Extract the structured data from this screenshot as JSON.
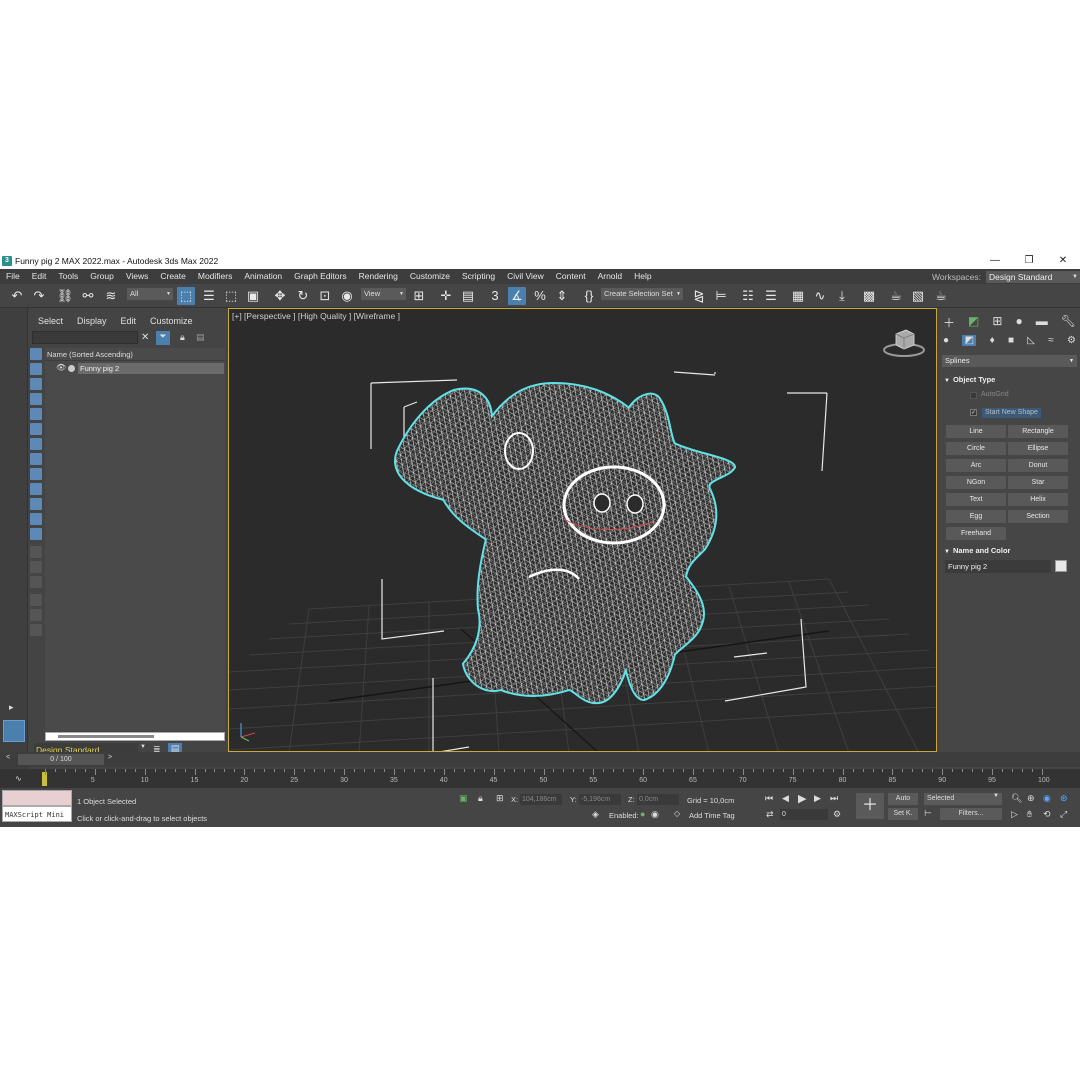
{
  "window": {
    "title": "Funny pig 2 MAX 2022.max - Autodesk 3ds Max 2022",
    "minimize": "—",
    "maximize": "❐",
    "close": "✕"
  },
  "menu": [
    "File",
    "Edit",
    "Tools",
    "Group",
    "Views",
    "Create",
    "Modifiers",
    "Animation",
    "Graph Editors",
    "Rendering",
    "Customize",
    "Scripting",
    "Civil View",
    "Content",
    "Arnold",
    "Help"
  ],
  "workspaces": {
    "label": "Workspaces:",
    "value": "Design Standard"
  },
  "toolbar": {
    "filter_value": "All",
    "ref_coord_value": "View",
    "selection_set_value": "Create Selection Set"
  },
  "scene_explorer": {
    "tabs": [
      "Select",
      "Display",
      "Edit",
      "Customize"
    ],
    "column_header": "Name (Sorted Ascending)",
    "items": [
      {
        "name": "Funny pig 2"
      }
    ],
    "workspace": "Design Standard"
  },
  "viewport": {
    "label": "[+] [Perspective ] [High Quality ] [Wireframe ]"
  },
  "command_panel": {
    "category": "Splines",
    "object_type": {
      "title": "Object Type",
      "autogrid": "AutoGrid",
      "start_new_shape": "Start New Shape",
      "buttons": [
        "Line",
        "Rectangle",
        "Circle",
        "Ellipse",
        "Arc",
        "Donut",
        "NGon",
        "Star",
        "Text",
        "Helix",
        "Egg",
        "Section",
        "Freehand"
      ]
    },
    "name_and_color": {
      "title": "Name and Color",
      "name": "Funny pig 2",
      "color": "#e8e8e8"
    }
  },
  "timeline": {
    "slider": "0 / 100",
    "labels": [
      "5",
      "10",
      "15",
      "20",
      "25",
      "30",
      "35",
      "40",
      "45",
      "50",
      "55",
      "60",
      "65",
      "70",
      "75",
      "80",
      "85",
      "90",
      "95",
      "100"
    ]
  },
  "status": {
    "maxscript": "MAXScript Mini",
    "selected": "1 Object Selected",
    "prompt": "Click or click-and-drag to select objects",
    "x_label": "X:",
    "x_value": "104,186cm",
    "y_label": "Y:",
    "y_value": "-5,196cm",
    "z_label": "Z:",
    "z_value": "0,0cm",
    "grid": "Grid = 10,0cm",
    "enabled": "Enabled:",
    "add_time_tag": "Add Time Tag",
    "auto": "Auto",
    "set_key": "Set K.",
    "key_filter": "Selected",
    "filters": "Filters...",
    "frame": "0"
  },
  "colors": {
    "accent": "#4a7fae",
    "viewport_border": "#c8a93e",
    "selection_outline": "#5fe3e8"
  }
}
